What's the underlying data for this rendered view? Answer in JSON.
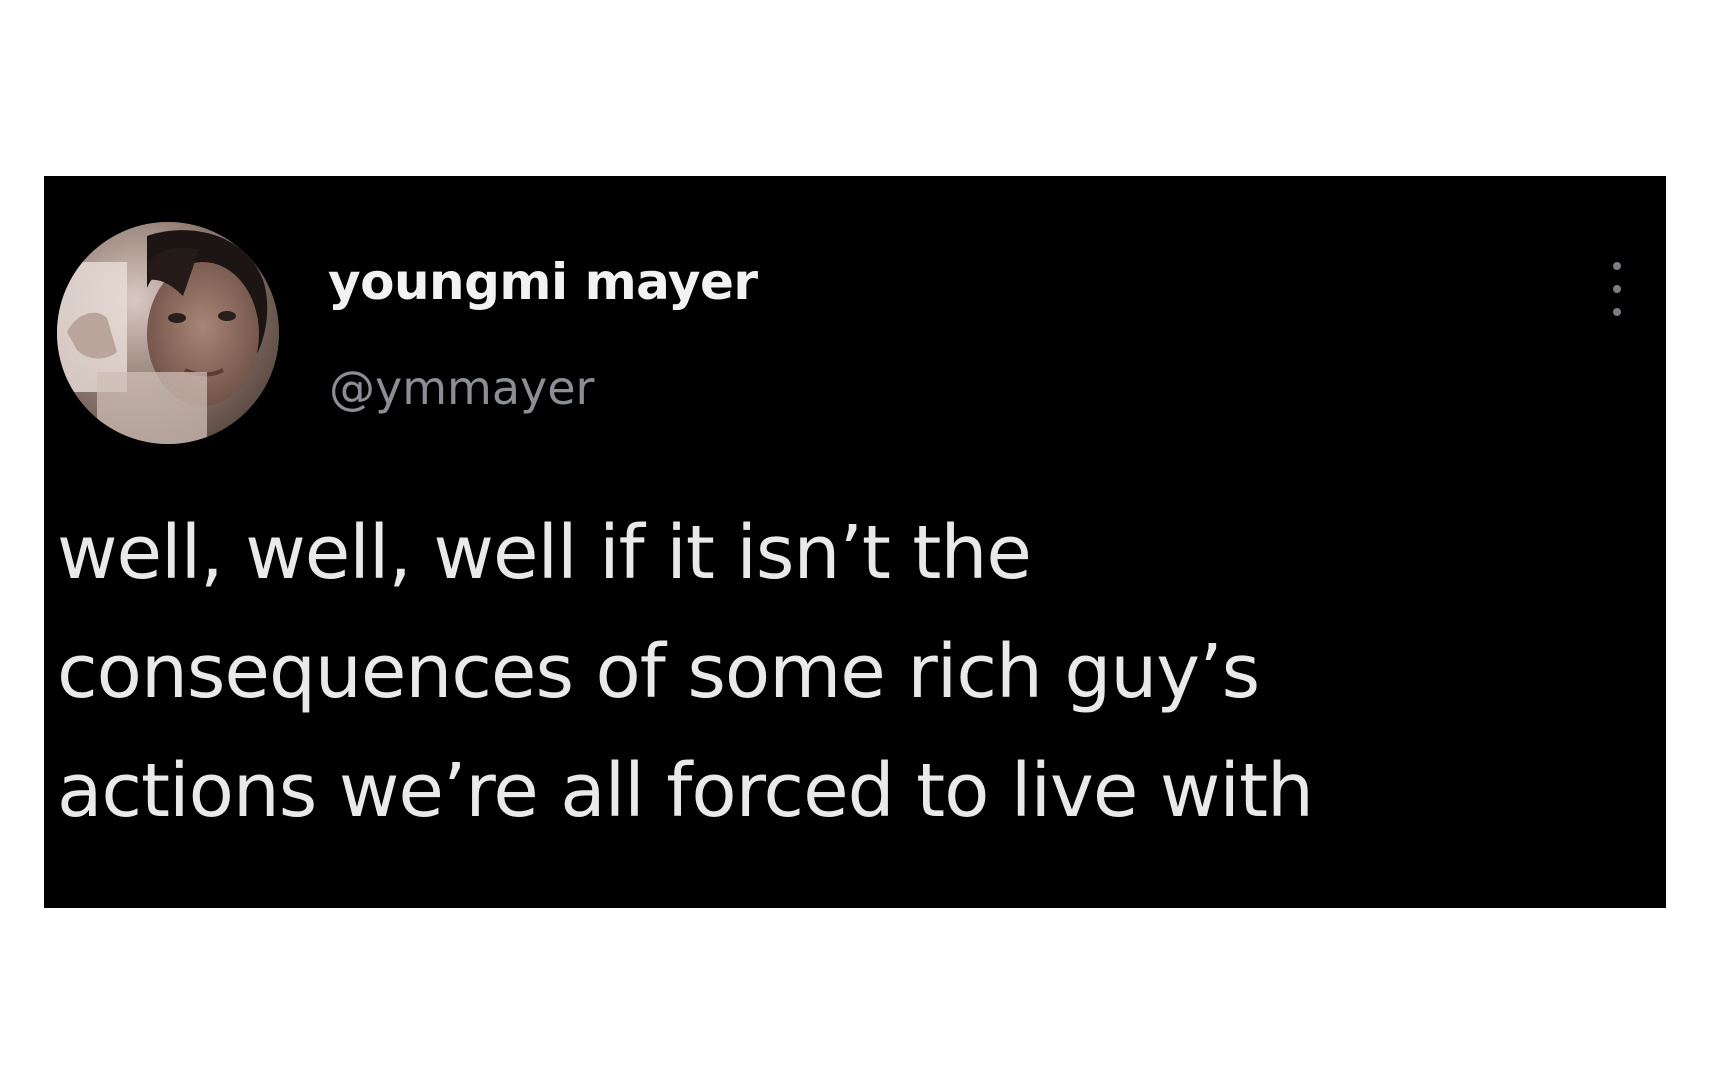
{
  "tweet": {
    "author": {
      "display_name": "youngmi mayer",
      "handle": "@ymmayer",
      "avatar_icon": "profile-photo"
    },
    "menu_icon": "more-vertical-icon",
    "text_lines": [
      "well, well, well if it isn’t the",
      "consequences of some rich guy’s",
      "actions we’re all forced to live with"
    ],
    "colors": {
      "card_background": "#000000",
      "page_background": "#ffffff",
      "text": "#e9e9e9",
      "handle": "#8b8f94"
    }
  }
}
